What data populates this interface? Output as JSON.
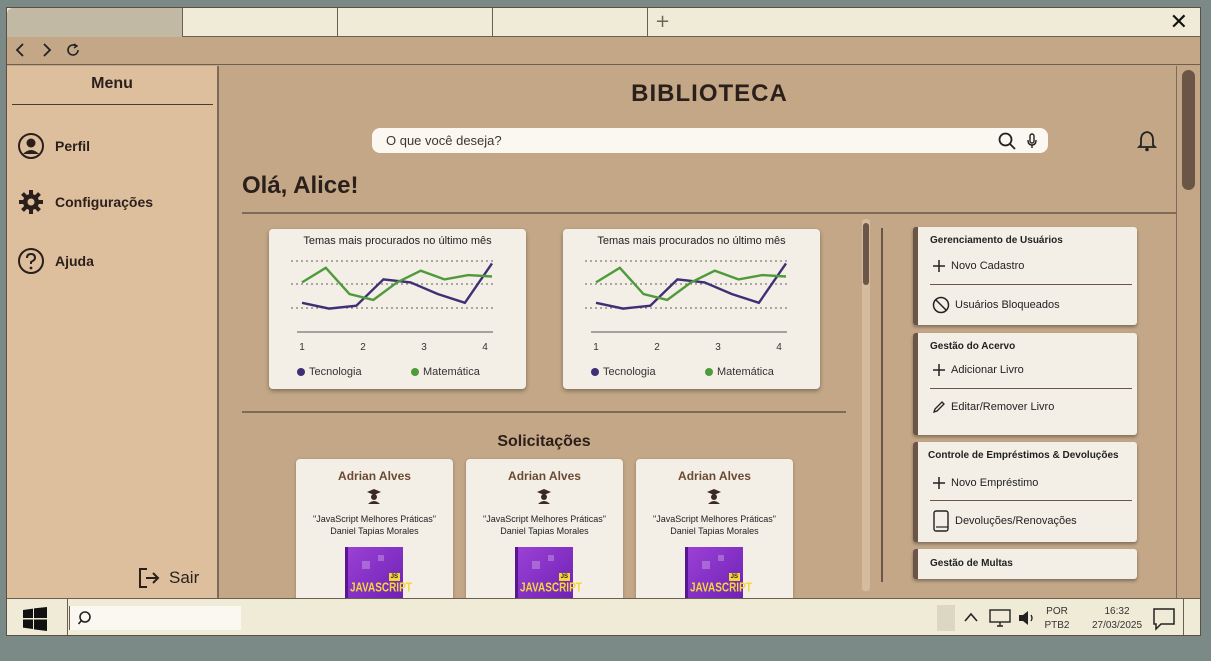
{
  "browser": {
    "tabs": [
      "",
      "",
      "",
      ""
    ],
    "new_tab": "+",
    "close": "✕"
  },
  "nav": {
    "back": "‹",
    "forward": "›",
    "reload": "⟳"
  },
  "sidebar": {
    "title": "Menu",
    "items": [
      {
        "label": "Perfil",
        "icon": "user-circle-icon"
      },
      {
        "label": "Configurações",
        "icon": "gear-icon"
      },
      {
        "label": "Ajuda",
        "icon": "help-circle-icon"
      }
    ],
    "logout": "Sair"
  },
  "header": {
    "title": "BIBLIOTECA",
    "search_placeholder": "O que você deseja?"
  },
  "greeting": "Olá, Alice!",
  "chart_data": [
    {
      "type": "line",
      "title": "Temas mais procurados no último mês",
      "x_ticks": [
        "1",
        "2",
        "3",
        "4"
      ],
      "series": [
        {
          "name": "Tecnologia",
          "color": "#3f2f75",
          "values": [
            2.0,
            1.6,
            1.8,
            3.6,
            3.4,
            2.6,
            2.0,
            4.7
          ]
        },
        {
          "name": "Matemática",
          "color": "#4f9a3b",
          "values": [
            3.4,
            4.4,
            2.6,
            2.2,
            3.4,
            4.2,
            3.6,
            3.9,
            3.8
          ]
        }
      ]
    },
    {
      "type": "line",
      "title": "Temas mais procurados no último mês",
      "x_ticks": [
        "1",
        "2",
        "3",
        "4"
      ],
      "series": [
        {
          "name": "Tecnologia",
          "color": "#3f2f75",
          "values": [
            2.0,
            1.6,
            1.8,
            3.6,
            3.4,
            2.6,
            2.0,
            4.7
          ]
        },
        {
          "name": "Matemática",
          "color": "#4f9a3b",
          "values": [
            3.4,
            4.4,
            2.6,
            2.2,
            3.4,
            4.2,
            3.6,
            3.9,
            3.8
          ]
        }
      ]
    }
  ],
  "requests": {
    "title": "Solicitações",
    "cards": [
      {
        "name": "Adrian Alves",
        "book": "\"JavaScript Melhores Práticas\"",
        "author": "Daniel Tapias Morales",
        "cover_word": "JAVASCRIPT",
        "cover_badge": "JS"
      },
      {
        "name": "Adrian Alves",
        "book": "\"JavaScript Melhores Práticas\"",
        "author": "Daniel Tapias Morales",
        "cover_word": "JAVASCRIPT",
        "cover_badge": "JS"
      },
      {
        "name": "Adrian Alves",
        "book": "\"JavaScript Melhores Práticas\"",
        "author": "Daniel Tapias Morales",
        "cover_word": "JAVASCRIPT",
        "cover_badge": "JS"
      }
    ]
  },
  "panels": [
    {
      "title": "Gerenciamento de Usuários",
      "actions": [
        "Novo Cadastro",
        "Usuários Bloqueados"
      ]
    },
    {
      "title": "Gestão do Acervo",
      "actions": [
        "Adicionar Livro",
        "Editar/Remover Livro"
      ]
    },
    {
      "title": "Controle de Empréstimos & Devoluções",
      "actions": [
        "Novo Empréstimo",
        "Devoluções/Renovações"
      ]
    },
    {
      "title": "Gestão de Multas",
      "actions": []
    }
  ],
  "taskbar": {
    "lang": "POR",
    "layout": "PTB2",
    "time": "16:32",
    "date": "27/03/2025"
  },
  "colors": {
    "background": "#c3a787",
    "sidebar": "#ddbf9e",
    "card": "#f3efe6",
    "accent": "#6b5546"
  }
}
